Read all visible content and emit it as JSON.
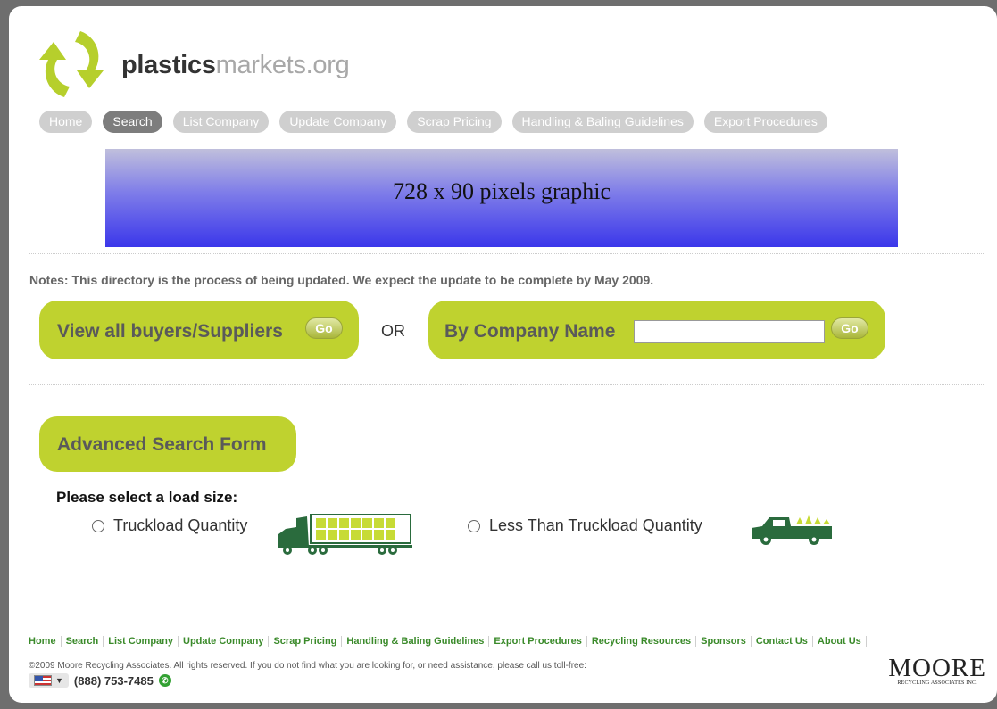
{
  "header": {
    "logo_bold": "plastics",
    "logo_light": "markets.org"
  },
  "nav": [
    {
      "label": "Home",
      "active": false
    },
    {
      "label": "Search",
      "active": true
    },
    {
      "label": "List Company",
      "active": false
    },
    {
      "label": "Update Company",
      "active": false
    },
    {
      "label": "Scrap Pricing",
      "active": false
    },
    {
      "label": "Handling & Baling Guidelines",
      "active": false
    },
    {
      "label": "Export Procedures",
      "active": false
    }
  ],
  "banner": {
    "text": "728 x 90 pixels graphic"
  },
  "notes": "Notes: This directory is the process of being updated. We expect the update to be complete by May 2009.",
  "search": {
    "view_all_label": "View all buyers/Suppliers",
    "go_label": "Go",
    "or_label": "OR",
    "company_label": "By Company Name",
    "company_value": ""
  },
  "advanced": {
    "title": "Advanced Search Form",
    "load_title": "Please select a load size:",
    "option_truckload": "Truckload Quantity",
    "option_ltl": "Less Than Truckload Quantity"
  },
  "footer": {
    "links": [
      "Home",
      "Search",
      "List Company",
      "Update Company",
      "Scrap Pricing",
      "Handling & Baling Guidelines",
      "Export Procedures",
      "Recycling Resources",
      "Sponsors",
      "Contact Us",
      "About Us"
    ],
    "copyright": "©2009 Moore Recycling Associates. All rights reserved. If you do not find what you are looking for, or need assistance, please call us toll-free:",
    "phone": "(888) 753-7485",
    "brand_big": "MOORE",
    "brand_small": "RECYCLING ASSOCIATES INC."
  },
  "colors": {
    "accent_green": "#bfd22f",
    "truck_green": "#2a6b3d",
    "nav_gray": "#cfcfcf",
    "nav_active": "#7d7d7d"
  }
}
